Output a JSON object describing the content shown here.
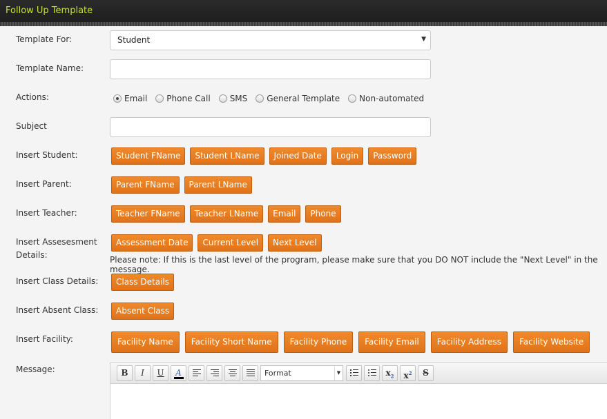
{
  "header": {
    "title": "Follow Up Template"
  },
  "form": {
    "template_for": {
      "label": "Template For:",
      "value": "Student"
    },
    "template_name": {
      "label": "Template Name:",
      "value": "",
      "placeholder": ""
    },
    "actions": {
      "label": "Actions:",
      "options": [
        "Email",
        "Phone Call",
        "SMS",
        "General Template",
        "Non-automated"
      ],
      "selected": "Email"
    },
    "subject": {
      "label": "Subject",
      "value": "",
      "placeholder": ""
    },
    "insert_student": {
      "label": "Insert Student:",
      "buttons": [
        "Student FName",
        "Student LName",
        "Joined Date",
        "Login",
        "Password"
      ]
    },
    "insert_parent": {
      "label": "Insert Parent:",
      "buttons": [
        "Parent FName",
        "Parent LName"
      ]
    },
    "insert_teacher": {
      "label": "Insert Teacher:",
      "buttons": [
        "Teacher FName",
        "Teacher LName",
        "Email",
        "Phone"
      ]
    },
    "insert_assessment": {
      "label_line1": "Insert Assesesment",
      "label_line2": "Details:",
      "buttons": [
        "Assessment Date",
        "Current Level",
        "Next Level"
      ],
      "note": "Please note: If this is the last level of the program, please make sure that you DO NOT include the \"Next Level\" in the message."
    },
    "insert_class": {
      "label": "Insert Class Details:",
      "buttons": [
        "Class Details"
      ]
    },
    "insert_absent": {
      "label": "Insert Absent Class:",
      "buttons": [
        "Absent Class"
      ]
    },
    "insert_facility": {
      "label": "Insert Facility:",
      "buttons": [
        "Facility Name",
        "Facility Short Name",
        "Facility Phone",
        "Facility Email",
        "Facility Address",
        "Facility Website"
      ]
    },
    "message": {
      "label": "Message:",
      "toolbar": {
        "bold": "B",
        "italic": "I",
        "underline": "U",
        "font_color": "A",
        "format": "Format",
        "subscript": "x",
        "subscript_mark": "2",
        "superscript": "x",
        "superscript_mark": "2",
        "strike": "S"
      }
    }
  }
}
